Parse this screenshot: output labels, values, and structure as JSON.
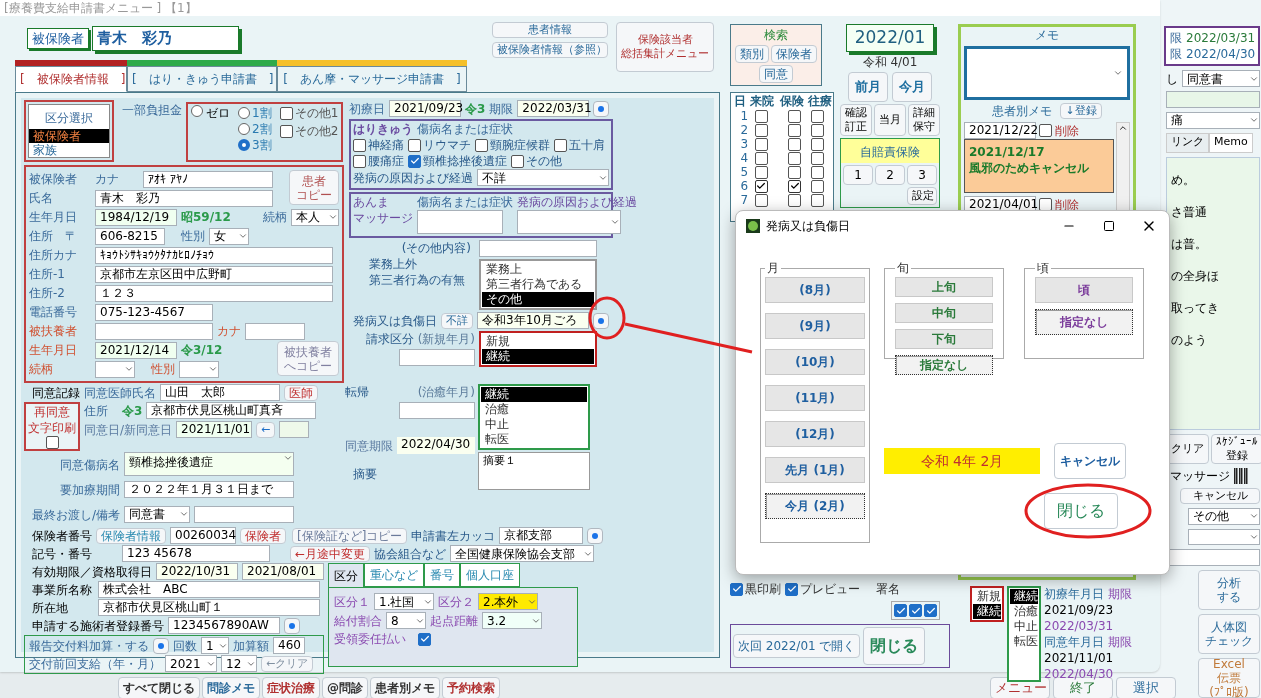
{
  "main_window": {
    "title": "[療養費支給申請書メニュー ]  【1】"
  },
  "insured": {
    "label": "被保険者",
    "name": "青木　彩乃"
  },
  "patient_info_button": "患者情報",
  "insured_ref_button": "被保険者情報（参照）",
  "summary_button": {
    "lines": [
      "保険該当者",
      "総括集計メニュー"
    ]
  },
  "tabs": [
    {
      "label": "[　被保険者情報　]",
      "color": "#b22222",
      "selected": true
    },
    {
      "label": "[　はり・きゅう申請書　]",
      "color": "#2eaa4a",
      "selected": false
    },
    {
      "label": "[　あん摩・マッサージ申請書　]",
      "color": "#f5c02a",
      "selected": false
    }
  ],
  "category": {
    "title": "区分選択",
    "options": [
      {
        "label": "被保険者",
        "selected": true
      },
      {
        "label": "家族",
        "selected": false
      }
    ]
  },
  "copay": {
    "label": "一部負担金",
    "options": [
      {
        "label": "ゼロ",
        "selected": false
      },
      {
        "label": "1割",
        "selected": false
      },
      {
        "label": "2割",
        "selected": false
      },
      {
        "label": "3割",
        "selected": true
      }
    ],
    "others": [
      {
        "label": "その他1",
        "checked": false
      },
      {
        "label": "その他2",
        "checked": false
      }
    ]
  },
  "person": {
    "section_label": "被保険者",
    "kana_label": "カナ",
    "kana": "ｱｵｷ ｱﾔﾉ",
    "copy_button": [
      "患者",
      "コピー"
    ],
    "name_label": "氏名",
    "name": "青木　彩乃",
    "birth_label": "生年月日",
    "birth": "1984/12/19",
    "era": "昭59/12",
    "relation_label": "続柄",
    "relation": "本人",
    "zip_label": "住所　〒",
    "zip": "606-8215",
    "sex_label": "性別",
    "sex": "女",
    "addr_kana_label": "住所カナ",
    "addr_kana": "ｷｮｳﾄｼｻｷｮｳｸﾀﾅｶﾋﾛﾉﾁｮｳ",
    "addr1_label": "住所-1",
    "addr1": "京都市左京区田中広野町",
    "addr2_label": "住所-2",
    "addr2": "１２３",
    "phone_label": "電話番号",
    "phone": "075-123-4567",
    "dep_label": "被扶養者",
    "dep_kana_label": "カナ",
    "dep_birth_label": "生年月日",
    "dep_birth": "2021/12/14",
    "dep_era": "令3/12",
    "dep_relation_label": "続柄",
    "dep_sex_label": "性別",
    "dep_copy_button": [
      "被扶養者",
      "へコピー"
    ]
  },
  "treatment": {
    "first_label": "初療日",
    "first": "2021/09/23",
    "era": "令3",
    "limit_label": "期限",
    "limit": "2022/03/31",
    "hari": {
      "tag": "はりきゅう",
      "title": "傷病名または症状",
      "conditions": [
        {
          "label": "神経痛",
          "checked": false
        },
        {
          "label": "リウマチ",
          "checked": false
        },
        {
          "label": "頸腕症候群",
          "checked": false
        },
        {
          "label": "五十肩",
          "checked": false
        },
        {
          "label": "腰痛症",
          "checked": false
        },
        {
          "label": "頸椎捻挫後遺症",
          "checked": true
        },
        {
          "label": "その他",
          "checked": false
        }
      ],
      "cause_label": "発病の原因および経過",
      "cause": "不詳"
    },
    "anma": {
      "tag": [
        "あんま",
        "マッサージ"
      ],
      "title": "傷病名または症状",
      "cause_label": "発病の原因および経過"
    },
    "other_label": "(その他内容)",
    "work_label": "業務上外",
    "third_label": "第三者行為の有無",
    "work_options": [
      {
        "label": "業務上",
        "selected": false
      },
      {
        "label": "第三者行為である",
        "selected": false
      },
      {
        "label": "その他",
        "selected": true
      }
    ],
    "onset_label": "発病又は負傷日",
    "unknown_button": "不詳",
    "onset": "令和3年10月ごろ",
    "request_label": "請求区分",
    "request_sub": "(新規年月)",
    "request_options": [
      {
        "label": "新規",
        "selected": false
      },
      {
        "label": "継続",
        "selected": true
      }
    ]
  },
  "consent": {
    "record_label": "同意記録",
    "doctor_label": "同意医師氏名",
    "doctor": "山田　太郎",
    "doctor_button": "医師",
    "reprint": {
      "lines": [
        "再同意",
        "文字印刷"
      ],
      "checked": false
    },
    "address_label": "住所",
    "era": "令3",
    "address": "京都市伏見区桃山町真斉",
    "date_label": "同意日/新同意日",
    "date": "2021/11/01",
    "arrow_button": "←",
    "limit_label": "同意期限",
    "limit": "2022/04/30",
    "disease_label": "同意傷病名",
    "disease": "頸椎捻挫後遺症",
    "period_label": "要加療期間",
    "period": "２０２２年１月３１日まで",
    "handover_label": "最終お渡し/備考",
    "handover": "同意書"
  },
  "outcome": {
    "label": "転帰",
    "sub_label": "(治癒年月)",
    "options": [
      {
        "label": "継続",
        "selected": true
      },
      {
        "label": "治癒",
        "selected": false
      },
      {
        "label": "中止",
        "selected": false
      },
      {
        "label": "転医",
        "selected": false
      }
    ]
  },
  "remarks": {
    "label": "摘要",
    "value": "摘要１"
  },
  "insurer": {
    "number_label": "保険者番号",
    "info_button": "保険者情報",
    "number": "00260034",
    "insurer_button": "保険者",
    "copy_button": "[保険証など]コピー",
    "symbol_label": "記号・番号",
    "symbol": "123 45678",
    "change_button": "←月途中変更",
    "validity_label": "有効期限／資格取得日",
    "validity": "2022/10/31",
    "acquired": "2021/08/01",
    "office_label": "事業所名称",
    "office": "株式会社　ABC",
    "location_label": "所在地",
    "location": "京都市伏見区桃山町１",
    "reg_label": "申請する施術者登録番号",
    "reg": "1234567890AW",
    "bracket_label": "申請書左カッコ",
    "bracket": "京都支部",
    "assoc_label": "協会組合など",
    "assoc": "全国健康保険協会支部"
  },
  "report": {
    "add_label": "報告交付料加算・する",
    "count_label": "回数",
    "count": "1",
    "amount_label": "加算額",
    "amount": "460",
    "prev_label": "交付前回支給（年・月）",
    "year": "2021",
    "month": "12",
    "clear_button": "←クリア"
  },
  "kubun": {
    "tabs": [
      {
        "label": "区分",
        "selected": true
      },
      {
        "label": "重心など",
        "selected": false
      },
      {
        "label": "番号",
        "selected": false
      },
      {
        "label": "個人口座",
        "selected": false
      }
    ],
    "k1_label": "区分１",
    "k1": "1.社国",
    "k2_label": "区分２",
    "k2": "2.本外",
    "ratio_label": "給付割合",
    "ratio": "8",
    "distance_label": "起点距離",
    "distance": "3.2",
    "delegation_label": "受領委任払い",
    "delegation": true
  },
  "search": {
    "title": "検索",
    "buttons": [
      "類別",
      "保険者",
      "同意"
    ]
  },
  "period": {
    "month": "2022/01",
    "era": "令和 4/01",
    "buttons": [
      "前月",
      "今月"
    ],
    "tools": [
      [
        "確認",
        "訂正"
      ],
      [
        "当月"
      ],
      [
        "詳細",
        "保守"
      ]
    ]
  },
  "jibaiseki": {
    "title": "自賠責保険",
    "buttons": [
      "1",
      "2",
      "3"
    ],
    "setting": "設定"
  },
  "calendar": {
    "headers": [
      "日",
      "来院",
      "保険",
      "往療"
    ],
    "rows": [
      {
        "day": "1",
        "visit": false,
        "insurance": false,
        "house_call": false
      },
      {
        "day": "2",
        "visit": false,
        "insurance": false,
        "house_call": false
      },
      {
        "day": "3",
        "visit": false,
        "insurance": false,
        "house_call": false
      },
      {
        "day": "4",
        "visit": false,
        "insurance": false,
        "house_call": false
      },
      {
        "day": "5",
        "visit": false,
        "insurance": false,
        "house_call": false
      },
      {
        "day": "6",
        "visit": true,
        "insurance": true,
        "house_call": false
      },
      {
        "day": "7",
        "visit": false,
        "insurance": false,
        "house_call": false
      }
    ]
  },
  "print": {
    "options": [
      {
        "label": "黒印刷",
        "checked": true
      },
      {
        "label": "プレビュー",
        "checked": true
      }
    ],
    "signature_label": "署名",
    "signatures": [
      {
        "checked": true
      },
      {
        "checked": true
      },
      {
        "checked": true
      }
    ]
  },
  "next_open_button": "次回 2022/01 で開く",
  "close_button": "閉じる",
  "memo": {
    "title": "メモ",
    "patient_memo_label": "患者別メモ",
    "register_button": "↓登録",
    "entries": [
      {
        "date": "2021/12/22",
        "delete_label": "削除",
        "delete": false,
        "lines": [
          "2021/12/17",
          "風邪のためキャンセル"
        ]
      },
      {
        "date": "2021/04/01",
        "delete_label": "削除",
        "delete": false
      }
    ]
  },
  "status_lists": {
    "request": [
      {
        "label": "新規",
        "selected": false
      },
      {
        "label": "継続",
        "selected": true
      }
    ],
    "outcome": [
      {
        "label": "継続",
        "selected": true
      },
      {
        "label": "治癒",
        "selected": false
      },
      {
        "label": "中止",
        "selected": false
      },
      {
        "label": "転医",
        "selected": false
      }
    ]
  },
  "summary_dates": {
    "first_label": "初療年月日",
    "first_limit_label": "期限",
    "first": "2021/09/23",
    "first_limit": "2022/03/31",
    "consent_label": "同意年月日",
    "consent_limit_label": "期限",
    "consent": "2021/11/01",
    "consent_limit": "2022/04/30"
  },
  "background_window": {
    "limits": [
      {
        "label": "限",
        "value": "2022/03/31"
      },
      {
        "label": "限",
        "value": "2022/04/30"
      }
    ],
    "handover_label": "し",
    "handover": "同意書",
    "disease": "痛",
    "tabs": [
      {
        "label": "リンク",
        "selected": false
      },
      {
        "label": "Memo",
        "selected": true
      }
    ],
    "notes": [
      "め。",
      "さ普通",
      "は普。",
      "の全身ほ",
      "取ってき",
      "のよう"
    ],
    "clear_button": "クリア",
    "schedule_button": [
      "ｽｹｼﾞｭｰﾙ",
      "登録"
    ],
    "massage_label": "マッサージ",
    "cancel_button": "キャンセル",
    "other_select": "その他",
    "side_buttons": [
      [
        "分析",
        "する"
      ],
      [
        "人体図",
        "チェック"
      ],
      [
        "Excel",
        "伝票",
        "(ﾌﾟﾛ版)"
      ]
    ],
    "bottom_buttons": [
      "メニュー",
      "終了",
      "選択"
    ]
  },
  "taskbar_buttons": [
    "すべて閉じる",
    "問診メモ",
    "症状治療",
    "@問診",
    "患者別メモ",
    "予約検索"
  ],
  "dialog": {
    "title": "発病又は負傷日",
    "month": {
      "title": "月",
      "options": [
        {
          "label": "(8月)",
          "selected": false
        },
        {
          "label": "(9月)",
          "selected": false
        },
        {
          "label": "(10月)",
          "selected": false
        },
        {
          "label": "(11月)",
          "selected": false
        },
        {
          "label": "(12月)",
          "selected": false
        },
        {
          "label": "先月 (1月)",
          "selected": false
        },
        {
          "label": "今月 (2月)",
          "selected": true
        }
      ]
    },
    "period": {
      "title": "旬",
      "options": [
        {
          "label": "上旬",
          "selected": false
        },
        {
          "label": "中旬",
          "selected": false
        },
        {
          "label": "下旬",
          "selected": false
        },
        {
          "label": "指定なし",
          "selected": true
        }
      ]
    },
    "approx": {
      "title": "頃",
      "options": [
        {
          "label": "頃",
          "selected": false
        },
        {
          "label": "指定なし",
          "selected": true
        }
      ]
    },
    "result": "令和 4年 2月",
    "cancel_button": "キャンセル",
    "close_button": "閉じる"
  }
}
